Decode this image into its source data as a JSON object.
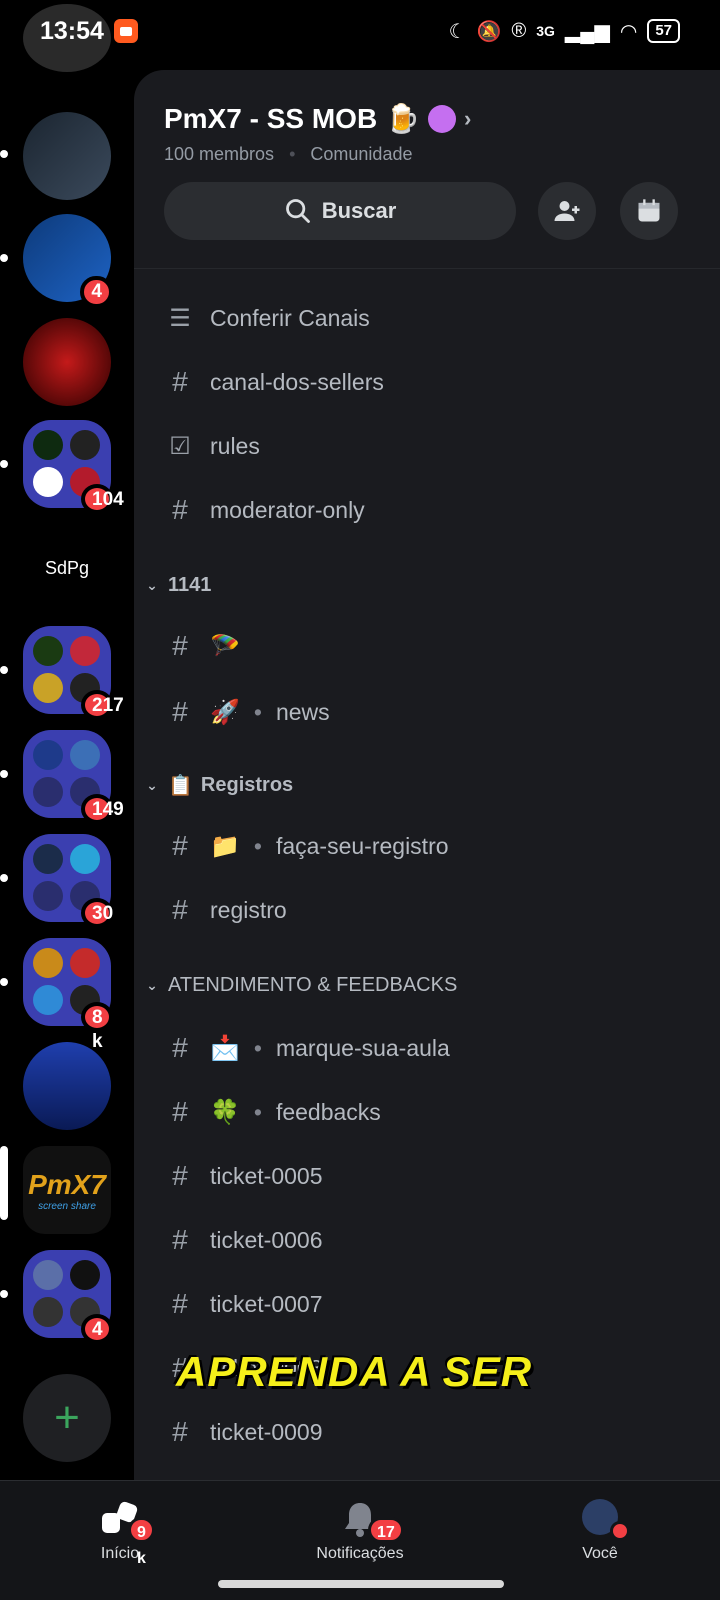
{
  "status_bar": {
    "time": "13:54",
    "network": "3G",
    "battery": "57"
  },
  "rail": {
    "items": [
      {
        "name": "server-capcut",
        "badge": ""
      },
      {
        "name": "server-code",
        "badge": ""
      },
      {
        "name": "server-hawk-esports",
        "badge": "4"
      },
      {
        "name": "server-hawk",
        "badge": ""
      },
      {
        "name": "folder-1",
        "badge": "104"
      },
      {
        "name": "server-sdpg",
        "label": "SdPg",
        "badge": ""
      },
      {
        "name": "folder-2",
        "badge": "217"
      },
      {
        "name": "folder-3",
        "badge": "149"
      },
      {
        "name": "folder-4",
        "badge": "30"
      },
      {
        "name": "folder-5",
        "badge": "8 k"
      },
      {
        "name": "server-vem-jogar",
        "badge": ""
      },
      {
        "name": "server-pmx7",
        "label": "PmX7",
        "sublabel": "screen share",
        "badge": ""
      },
      {
        "name": "folder-6",
        "badge": "4"
      }
    ],
    "add_label": "+"
  },
  "server": {
    "title": "PmX7 - SS MOB",
    "title_emoji": "🍺",
    "members": "100 membros",
    "type": "Comunidade",
    "search_label": "Buscar"
  },
  "channels": {
    "top": [
      {
        "icon": "browse",
        "label": "Conferir Canais"
      },
      {
        "icon": "#",
        "label": "canal-dos-sellers"
      },
      {
        "icon": "rules",
        "label": "rules"
      },
      {
        "icon": "#",
        "label": "moderator-only"
      }
    ],
    "cat1": {
      "label": "1141",
      "items": [
        {
          "emoji": "🪂",
          "label": ""
        },
        {
          "emoji": "🚀",
          "label": "news"
        }
      ]
    },
    "cat2": {
      "emoji": "📋",
      "label": "Registros",
      "items": [
        {
          "emoji": "📁",
          "label": "faça-seu-registro"
        },
        {
          "label": "registro"
        }
      ]
    },
    "cat3": {
      "label": "ATENDIMENTO & FEEDBACKS",
      "items": [
        {
          "emoji": "📩",
          "label": "marque-sua-aula"
        },
        {
          "emoji": "🍀",
          "label": "feedbacks"
        },
        {
          "label": "ticket-0005"
        },
        {
          "label": "ticket-0006"
        },
        {
          "label": "ticket-0007"
        },
        {
          "label": "ticket-0008"
        },
        {
          "label": "ticket-0009"
        }
      ]
    }
  },
  "overlay": {
    "caption": "APRENDA A SER"
  },
  "bottom_nav": {
    "home": {
      "label": "Início",
      "badge": "9 k"
    },
    "notifications": {
      "label": "Notificações",
      "badge": "17"
    },
    "you": {
      "label": "Você"
    }
  },
  "colors": {
    "accent": "#f23f43",
    "panel": "#1a1b1f",
    "caption": "#f5ef1a",
    "folder": "#3b3fb0"
  }
}
